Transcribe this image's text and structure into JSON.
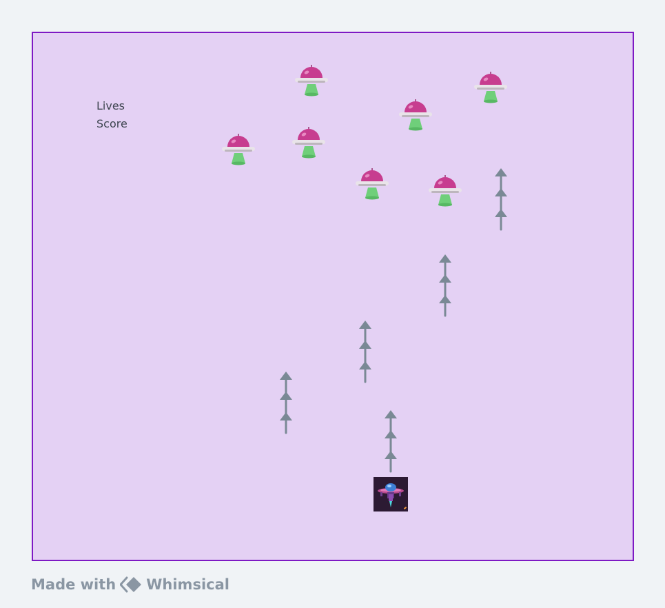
{
  "hud": {
    "lives_label": "Lives",
    "score_label": "Score"
  },
  "footer": {
    "made_with": "Made with",
    "brand": "Whimsical"
  },
  "colors": {
    "frame_border": "#7e19c4",
    "frame_fill": "#e4d1f4",
    "ufo_dome": "#c73d8f",
    "ufo_beam": "#6fcf7a",
    "missile": "#7a8995"
  },
  "icons": {
    "enemy": "ufo-icon",
    "projectile": "arrow-missile-icon",
    "player": "spaceship-icon",
    "brand": "whimsical-logo-icon"
  }
}
